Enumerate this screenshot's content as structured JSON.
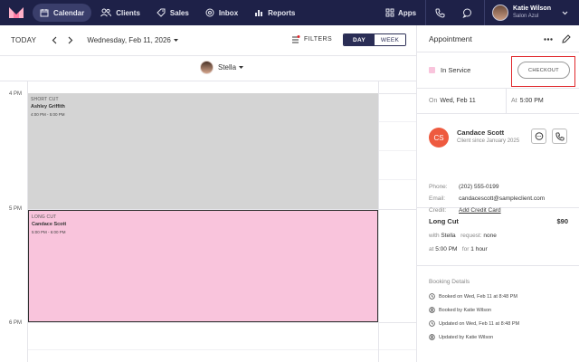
{
  "nav": {
    "items": [
      {
        "label": "Calendar",
        "icon": "calendar-icon",
        "active": true
      },
      {
        "label": "Clients",
        "icon": "clients-icon"
      },
      {
        "label": "Sales",
        "icon": "sales-icon"
      },
      {
        "label": "Inbox",
        "icon": "inbox-icon"
      },
      {
        "label": "Reports",
        "icon": "reports-icon"
      }
    ],
    "apps_label": "Apps",
    "user": {
      "name": "Katie Wilson",
      "salon": "Salon Azul"
    }
  },
  "toolbar": {
    "today_label": "TODAY",
    "date_label": "Wednesday, Feb 11, 2026",
    "filters_label": "FILTERS",
    "views": [
      "DAY",
      "WEEK"
    ],
    "active_view": "DAY"
  },
  "staff": {
    "name": "Stella"
  },
  "grid": {
    "time_labels": [
      "4 PM",
      "5 PM",
      "6 PM"
    ],
    "appointments": [
      {
        "service": "SHORT CUT",
        "client": "Ashley Griffith",
        "time": "4:00 PM - 5:00 PM",
        "color": "#d4d4d4"
      },
      {
        "service": "LONG CUT",
        "client": "Candace Scott",
        "time": "5:00 PM - 6:00 PM",
        "color": "#f9c4dc"
      }
    ]
  },
  "panel": {
    "title": "Appointment",
    "status": "In Service",
    "status_color": "#f9c4dc",
    "checkout_label": "CHECKOUT",
    "date_prefix": "On",
    "date": "Wed, Feb 11",
    "time_prefix": "At",
    "time": "5:00 PM",
    "client": {
      "initials": "CS",
      "name": "Candace Scott",
      "since": "Client since January 2025",
      "phone_label": "Phone:",
      "phone": "(202) 555-0199",
      "email_label": "Email:",
      "email": "candacescott@sampleclient.com",
      "credit_label": "Credit:",
      "credit_link": "Add Credit Card"
    },
    "service": {
      "name": "Long Cut",
      "price": "$90",
      "with_label": "with",
      "staff": "Stella",
      "request_label": "request:",
      "request": "none",
      "at_label": "at",
      "time": "5:00 PM",
      "for_label": "for",
      "duration": "1 hour"
    },
    "booking": {
      "title": "Booking Details",
      "items": [
        "Booked on Wed, Feb 11 at 8:48 PM",
        "Booked by Katie Wilson",
        "Updated on Wed, Feb 11 at 8:48 PM",
        "Updated by Katie Wilson"
      ]
    }
  }
}
